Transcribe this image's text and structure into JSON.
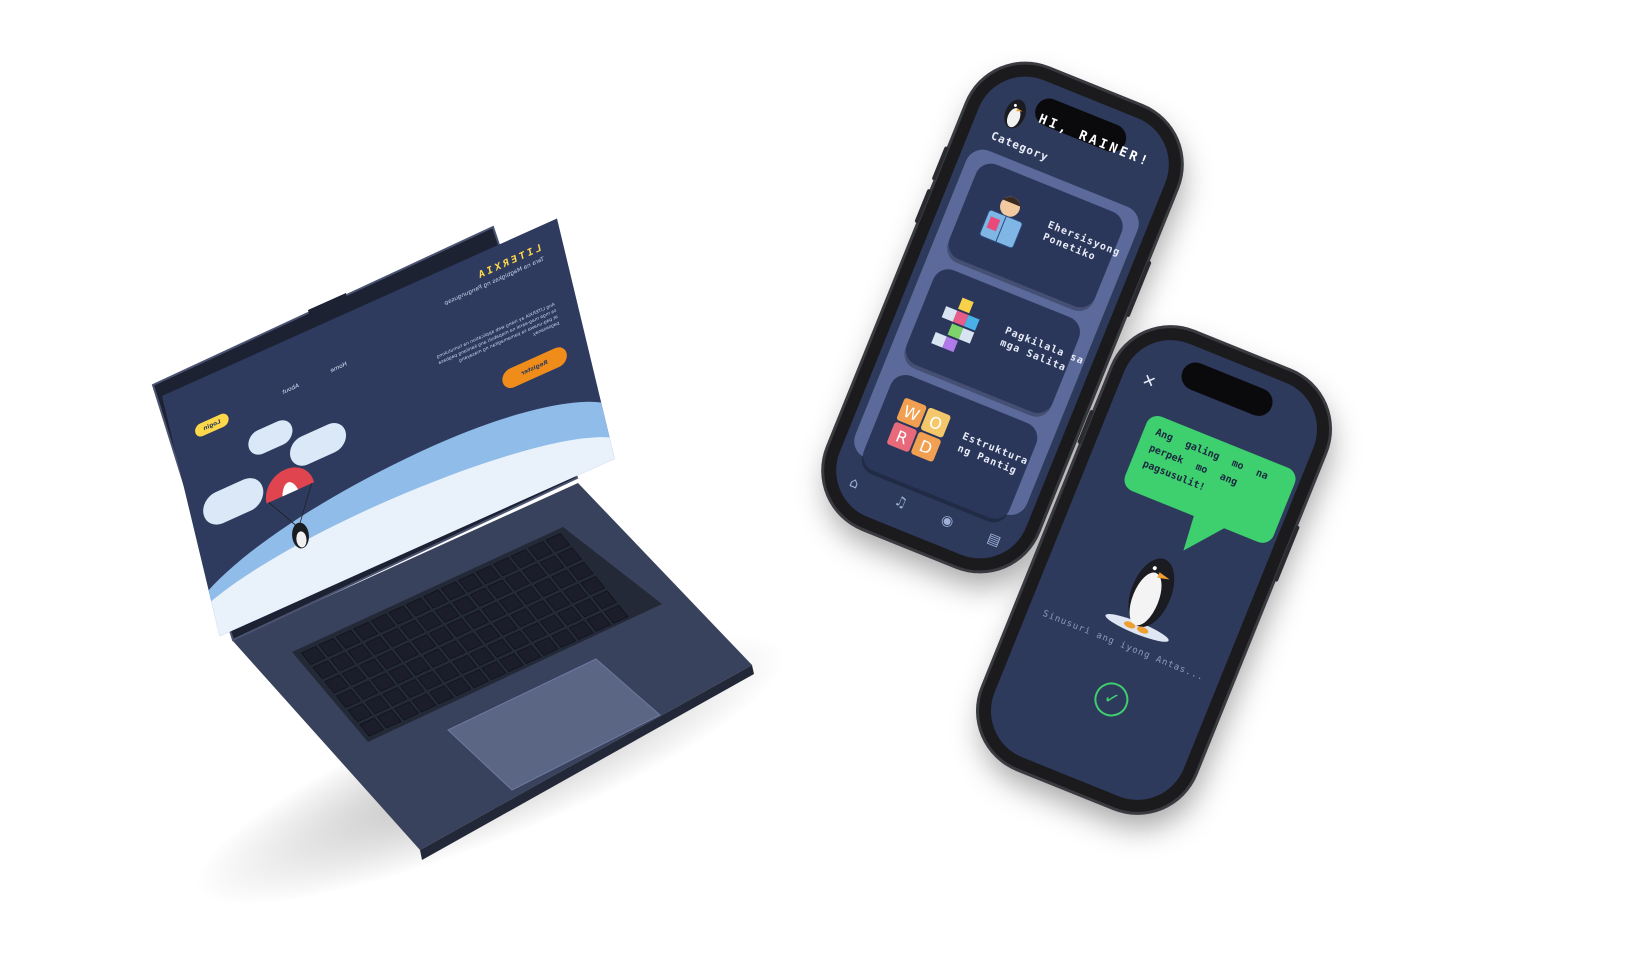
{
  "laptop": {
    "site": {
      "logo": "LITERXIA",
      "tagline": "Tara na Magbigkas ng Pangungusap",
      "nav": [
        "Home",
        "About"
      ],
      "login_label": "Login",
      "description": "Ang LITERXIA ay isang web application na tumutulong sa mga mag-aaral na mapabuti ang kanilang pagbasa at pag-unawa sa pamamagitan ng masayang pagsasanay.",
      "register_label": "Register"
    }
  },
  "phone_category": {
    "greeting": "HI, RAINER!",
    "category_title": "Category",
    "categories": [
      {
        "label": "Ehersisyong Ponetiko",
        "icon": "reading-kid-icon"
      },
      {
        "label": "Pagkilala sa mga Salita",
        "icon": "word-grid-icon"
      },
      {
        "label": "Estruktura ng Pantig",
        "icon": "word-blocks-icon"
      }
    ],
    "nav_items": [
      "home-icon",
      "bell-icon",
      "eye-icon",
      "book-icon"
    ]
  },
  "phone_result": {
    "close_label": "✕",
    "bubble_text": "Ang galing mo na perpek mo ang pagsusulit!",
    "status_text": "Sinusuri ang iyong Antas...",
    "check_label": "✓"
  },
  "colors": {
    "app_bg": "#2e3a5c",
    "panel": "#5b6a9a",
    "accent_green": "#3ecf6e",
    "accent_yellow": "#ffd84a",
    "accent_orange": "#f08c1a"
  }
}
